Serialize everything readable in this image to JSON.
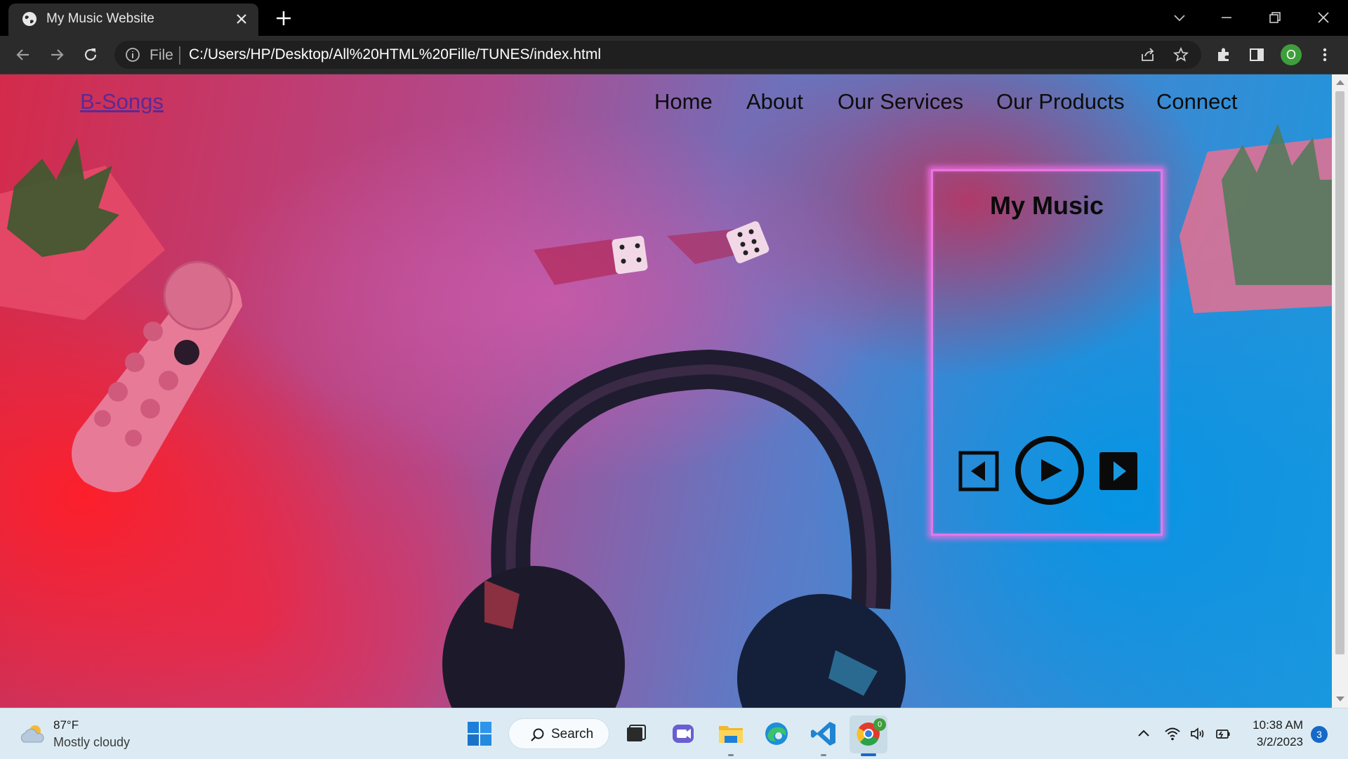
{
  "browser": {
    "tab_title": "My Music Website",
    "omnibox_scheme_label": "File",
    "url": "C:/Users/HP/Desktop/All%20HTML%20Fille/TUNES/index.html",
    "profile_initial": "O"
  },
  "site": {
    "brand": "B-Songs",
    "nav": [
      "Home",
      "About",
      "Our Services",
      "Our Products",
      "Connect"
    ],
    "player": {
      "title": "My Music",
      "controls": [
        "previous-icon",
        "play-icon",
        "next-icon"
      ]
    }
  },
  "taskbar": {
    "weather_temp": "87°F",
    "weather_desc": "Mostly cloudy",
    "search_label": "Search",
    "chrome_badge": "0",
    "time": "10:38 AM",
    "date": "3/2/2023",
    "notification_count": "3"
  },
  "colors": {
    "brand_link": "#5b2a94",
    "card_glow": "#f078e6",
    "accent": "#1669c7"
  }
}
